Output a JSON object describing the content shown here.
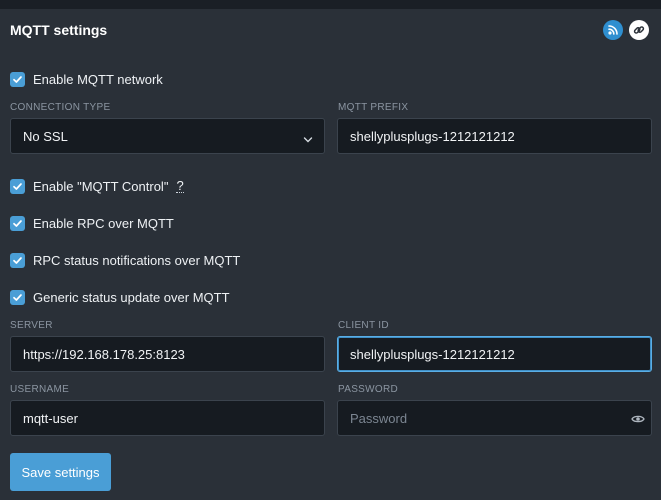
{
  "header": {
    "title": "MQTT settings",
    "icons": [
      "rss-icon",
      "link-icon"
    ]
  },
  "checkboxes": {
    "enable_mqtt": {
      "label": "Enable MQTT network",
      "checked": true
    },
    "mqtt_control": {
      "label": "Enable \"MQTT Control\"",
      "checked": true,
      "help": "?"
    },
    "rpc_over_mqtt": {
      "label": "Enable RPC over MQTT",
      "checked": true
    },
    "rpc_status": {
      "label": "RPC status notifications over MQTT",
      "checked": true
    },
    "generic_status": {
      "label": "Generic status update over MQTT",
      "checked": true
    }
  },
  "fields": {
    "connection_type": {
      "label": "CONNECTION TYPE",
      "value": "No SSL"
    },
    "mqtt_prefix": {
      "label": "MQTT PREFIX",
      "value": "shellyplusplugs-1212121212"
    },
    "server": {
      "label": "SERVER",
      "value": "https://192.168.178.25:8123"
    },
    "client_id": {
      "label": "CLIENT ID",
      "value": "shellyplusplugs-1212121212"
    },
    "username": {
      "label": "USERNAME",
      "value": "mqtt-user"
    },
    "password": {
      "label": "PASSWORD",
      "value": "",
      "placeholder": "Password"
    }
  },
  "actions": {
    "save_label": "Save settings"
  },
  "colors": {
    "accent": "#4a9ed6",
    "panel": "#2a3038",
    "input_bg": "#161b21",
    "focus_border": "#5aaee6"
  }
}
